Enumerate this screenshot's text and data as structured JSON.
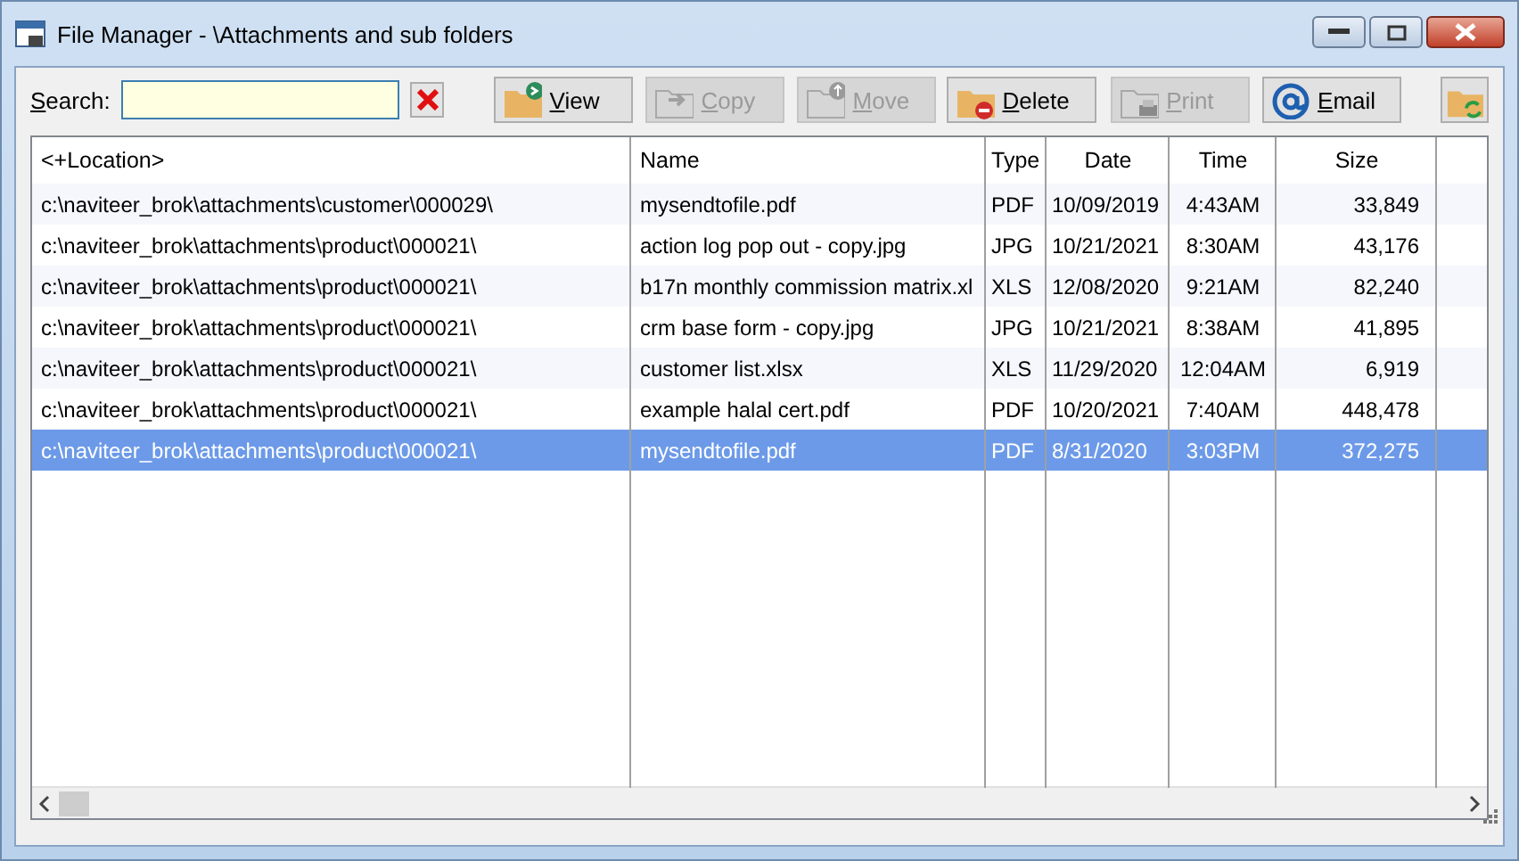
{
  "window": {
    "title": "File Manager - \\Attachments and sub folders"
  },
  "search": {
    "label_key": "S",
    "label_rest": "earch:"
  },
  "toolbar": [
    {
      "kind": "view",
      "key": "V",
      "rest": "iew",
      "disabled": false
    },
    {
      "kind": "copy",
      "key": "C",
      "rest": "opy",
      "disabled": true
    },
    {
      "kind": "move",
      "key": "M",
      "rest": "ove",
      "disabled": true
    },
    {
      "kind": "delete",
      "key": "D",
      "rest": "elete",
      "disabled": false
    },
    {
      "kind": "print",
      "key": "P",
      "rest": "rint",
      "disabled": true
    },
    {
      "kind": "email",
      "key": "E",
      "rest": "mail",
      "disabled": false
    },
    {
      "kind": "refresh",
      "disabled": false
    }
  ],
  "table": {
    "columns": [
      "<+Location>",
      "Name",
      "Type",
      "Date",
      "Time",
      "Size"
    ],
    "rows": [
      {
        "cells": [
          "c:\\naviteer_brok\\attachments\\customer\\000029\\",
          "mysendtofile.pdf",
          "PDF",
          "10/09/2019",
          "4:43AM",
          "33,849"
        ],
        "selected": false
      },
      {
        "cells": [
          "c:\\naviteer_brok\\attachments\\product\\000021\\",
          "action log pop out - copy.jpg",
          "JPG",
          "10/21/2021",
          "8:30AM",
          "43,176"
        ],
        "selected": false
      },
      {
        "cells": [
          "c:\\naviteer_brok\\attachments\\product\\000021\\",
          "b17n monthly commission matrix.xl",
          "XLS",
          "12/08/2020",
          "9:21AM",
          "82,240"
        ],
        "selected": false
      },
      {
        "cells": [
          "c:\\naviteer_brok\\attachments\\product\\000021\\",
          "crm base form - copy.jpg",
          "JPG",
          "10/21/2021",
          "8:38AM",
          "41,895"
        ],
        "selected": false
      },
      {
        "cells": [
          "c:\\naviteer_brok\\attachments\\product\\000021\\",
          "customer list.xlsx",
          "XLS",
          "11/29/2020",
          "12:04AM",
          "6,919"
        ],
        "selected": false
      },
      {
        "cells": [
          "c:\\naviteer_brok\\attachments\\product\\000021\\",
          "example halal cert.pdf",
          "PDF",
          "10/20/2021",
          "7:40AM",
          "448,478"
        ],
        "selected": false
      },
      {
        "cells": [
          "c:\\naviteer_brok\\attachments\\product\\000021\\",
          "mysendtofile.pdf",
          "PDF",
          "8/31/2020",
          "3:03PM",
          "372,275"
        ],
        "selected": true
      }
    ]
  }
}
